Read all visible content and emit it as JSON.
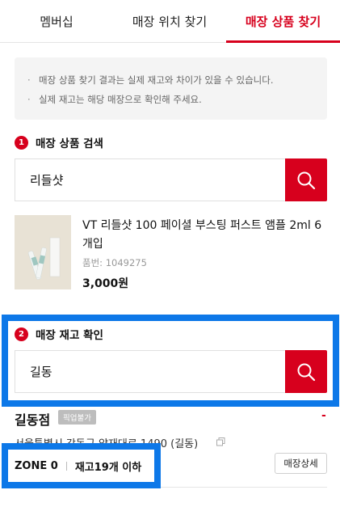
{
  "tabs": [
    {
      "label": "멤버십",
      "active": false
    },
    {
      "label": "매장 위치 찾기",
      "active": false
    },
    {
      "label": "매장 상품 찾기",
      "active": true
    }
  ],
  "notice": {
    "lines": [
      "매장 상품 찾기 결과는 실제 재고와 차이가 있을 수 있습니다.",
      "실제 재고는 해당 매장으로 확인해 주세요."
    ]
  },
  "step1": {
    "number": "1",
    "title": "매장 상품 검색",
    "search_value": "리들샷"
  },
  "product": {
    "name": "VT 리들샷 100 페이셜 부스팅 퍼스트 앰플 2ml 6개입",
    "code": "품번: 1049275",
    "price": "3,000원"
  },
  "step2": {
    "number": "2",
    "title": "매장 재고 확인",
    "search_value": "길동"
  },
  "store": {
    "name": "길동점",
    "pickup_badge": "픽업불가",
    "status_mark": "-",
    "address": "서울특별시 강동구 양재대로 1490 (길동)",
    "zone": "ZONE 0",
    "stock": "재고19개 이하",
    "detail_label": "매장상세"
  },
  "colors": {
    "brand_red": "#d7001d",
    "highlight_blue": "#0d78e8"
  },
  "icons": {
    "search": "magnifier-icon",
    "copy": "copy-icon"
  }
}
